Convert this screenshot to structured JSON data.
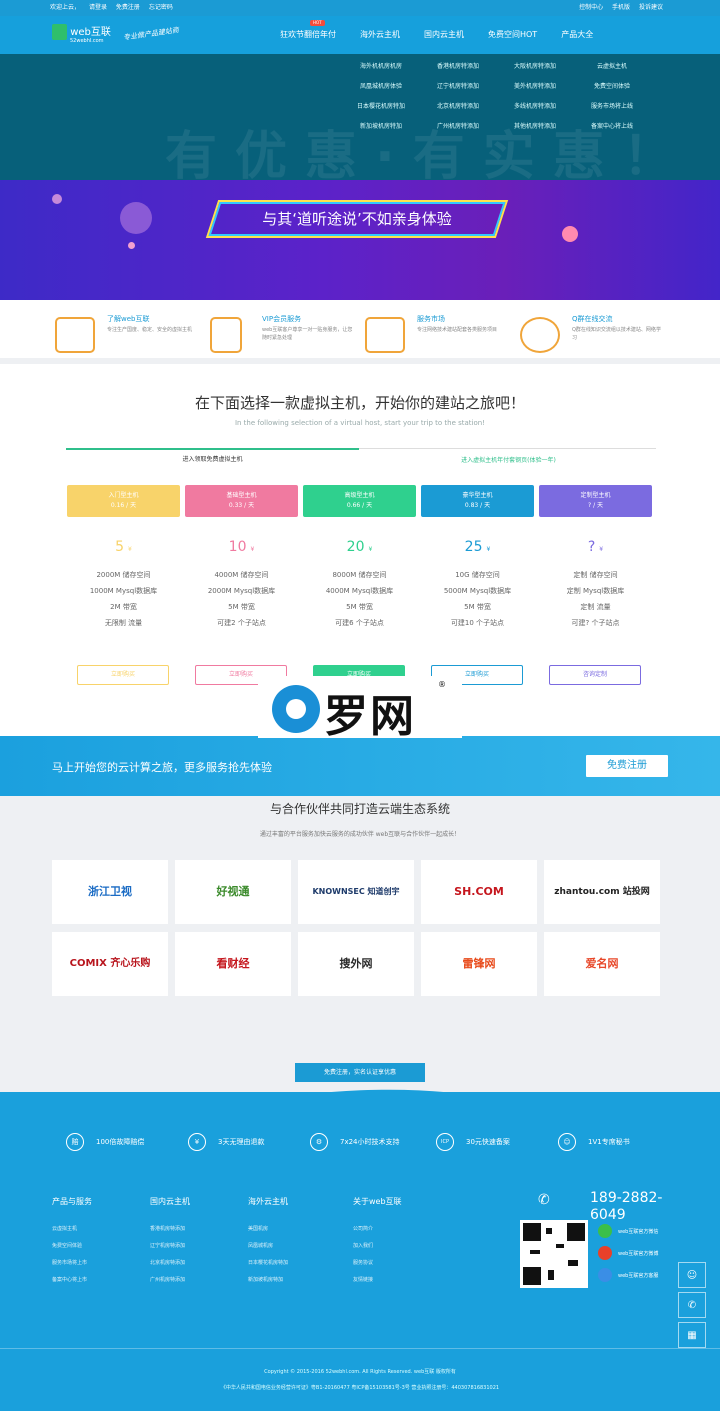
{
  "topbar": {
    "left": [
      "欢迎上云，",
      "请登录",
      "免费注册",
      "忘记密码"
    ],
    "right": [
      "控制中心",
      "手机版",
      "投诉建议"
    ]
  },
  "header": {
    "logo": "web互联",
    "logo_sub": "52webhl.com",
    "slogan": "专业做产品建站商",
    "nav": [
      "狂欢节翻倍年付",
      "海外云主机",
      "国内云主机",
      "免费空间HOT",
      "产品大全"
    ],
    "hot_badge": "HOT"
  },
  "dropdown": {
    "ghost_text": "有优惠·有实惠！",
    "links": [
      "海外机机房机房",
      "香港机房特添加",
      "大阪机房特添加",
      "云虚拟主机",
      "凤凰城机房体验",
      "辽宁机房特添加",
      "美外机房特添加",
      "免费空间体验",
      "日本樱花机房特加",
      "北京机房特添加",
      "多线机房特添加",
      "服务市场将上线",
      "新加坡机房特加",
      "广州机房特添加",
      "其他机房特添加",
      "备案中心将上线"
    ]
  },
  "banner": {
    "text": "与其‘道听途说’不如亲身体验"
  },
  "features": [
    {
      "title": "了解web互联",
      "desc": "专注生产国度、稳定、安全的虚拟主机"
    },
    {
      "title": "VIP会员服务",
      "desc": "web互联客户尊享一对一贴身服务，让您随时紧急处理"
    },
    {
      "title": "服务市场",
      "desc": "专注网络技术建站配套各类服务项目"
    },
    {
      "title": "Q群在线交流",
      "desc": "Q群在线知识交流组以技术建站、网络学习"
    }
  ],
  "hosts": {
    "title": "在下面选择一款虚拟主机，开始你的建站之旅吧！",
    "subtitle": "In the following selection of a virtual host, start your trip to the station!",
    "tab_active": "进入领取免费虚拟主机",
    "tab_other": "进入虚拟主机年付套钢页(体验一年)",
    "plans": [
      {
        "name": "入门型主机",
        "per_day": "0.16 / 天",
        "price": "5",
        "unit": "¥",
        "specs": [
          "2000M 储存空间",
          "1000M Mysql数据库",
          "2M 带宽",
          "无限制 流量"
        ],
        "btn": "立即购买",
        "color": "#f8d36a"
      },
      {
        "name": "基础型主机",
        "per_day": "0.33 / 天",
        "price": "10",
        "unit": "¥",
        "specs": [
          "4000M 储存空间",
          "2000M Mysql数据库",
          "5M 带宽",
          "可建2 个子站点"
        ],
        "btn": "立即购买",
        "color": "#f07aa0"
      },
      {
        "name": "高级型主机",
        "per_day": "0.66 / 天",
        "price": "20",
        "unit": "¥",
        "specs": [
          "8000M 储存空间",
          "4000M Mysql数据库",
          "5M 带宽",
          "可建6 个子站点"
        ],
        "btn": "立即购买",
        "color": "#2fd08e"
      },
      {
        "name": "豪华型主机",
        "per_day": "0.83 / 天",
        "price": "25",
        "unit": "¥",
        "specs": [
          "10G 储存空间",
          "5000M Mysql数据库",
          "5M 带宽",
          "可建10 个子站点"
        ],
        "btn": "立即购买",
        "color": "#1b9bd4"
      },
      {
        "name": "定制型主机",
        "per_day": "? / 天",
        "price": "?",
        "unit": "¥",
        "specs": [
          "定制 储存空间",
          "定制 Mysql数据库",
          "定制 流量",
          "可建? 个子站点"
        ],
        "btn": "咨询定制",
        "color": "#7b6be0"
      }
    ]
  },
  "watermark": {
    "name": "罗网",
    "reg": "®"
  },
  "cta": {
    "text": "马上开始您的云计算之旅，更多服务抢先体验",
    "button": "免费注册"
  },
  "partners": {
    "title": "与合作伙伴共同打造云端生态系统",
    "subtitle": "通过丰富的平台服务加快云服务的成功伙伴 web互联与合作伙伴一起成长！",
    "logos": [
      "浙江卫视",
      "好视通",
      "KNOWNSEC 知道创宇",
      "SH.COM",
      "zhantou.com 站投网",
      "COMIX 齐心乐购",
      "看财经",
      "搜外网",
      "雷锋网",
      "爱名网"
    ],
    "free_button": "免费注册，实名认证享优惠"
  },
  "footer": {
    "promos": [
      "100倍故障赔偿",
      "3天无理由退款",
      "7x24小时技术支持",
      "30元快速备案",
      "1V1专席秘书"
    ],
    "columns": [
      {
        "title": "产品与服务",
        "links": [
          "云虚拟主机",
          "免费空间体验",
          "服务市场将上市",
          "备案中心将上市"
        ]
      },
      {
        "title": "国内云主机",
        "links": [
          "香港机房特添加",
          "辽宁机房特添加",
          "北京机房特添加",
          "广州机房特添加"
        ]
      },
      {
        "title": "海外云主机",
        "links": [
          "美国机房",
          "凤凰城机房",
          "日本樱花机房特加",
          "新加坡机房特加"
        ]
      },
      {
        "title": "关于web互联",
        "links": [
          "公司简介",
          "加入我们",
          "服务协议",
          "友情链接"
        ]
      }
    ],
    "phone": "189-2882-6049",
    "social": [
      "web互联官方微信",
      "web互联官方微博",
      "web互联官方客服"
    ],
    "copyright": "Copyright © 2015-2016 52webhl.com. All Rights Reserved. web互联 版权所有",
    "license": "《中华人民共和国电信业务经营许可证》粤B1-20160477    粤ICP备15103581号-3号    营业执照注册号：440307816831021"
  }
}
